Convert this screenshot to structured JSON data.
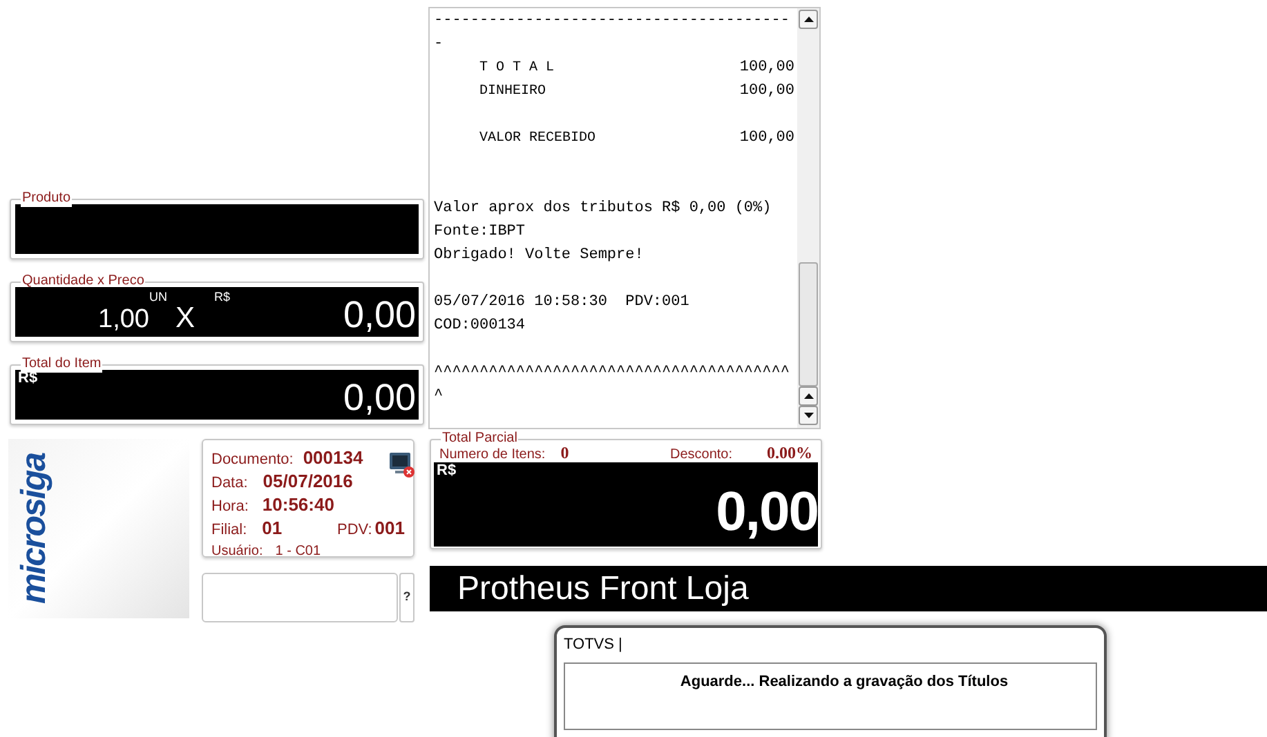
{
  "fields": [
    {
      "kind": "product",
      "legend": "Produto"
    },
    {
      "kind": "qty_price",
      "legend": "Quantidade x Preco",
      "quantity": "1,00",
      "unit": "UN",
      "times": "X",
      "currency": "R$",
      "price": "0,00"
    },
    {
      "kind": "item_total",
      "legend": "Total do Item",
      "currency": "R$",
      "value": "0,00"
    }
  ],
  "receipt": {
    "lines": [
      {
        "kind": "text",
        "text": "---------------------------------------"
      },
      {
        "kind": "text",
        "text": "-"
      },
      {
        "kind": "pair",
        "label": "T O T A L",
        "value": "100,00"
      },
      {
        "kind": "pair",
        "label": "DINHEIRO",
        "value": "100,00"
      },
      {
        "kind": "blank"
      },
      {
        "kind": "pair",
        "label": "VALOR RECEBIDO",
        "value": "100,00"
      },
      {
        "kind": "blank"
      },
      {
        "kind": "blank"
      },
      {
        "kind": "text",
        "text": "Valor aprox dos tributos R$ 0,00 (0%)"
      },
      {
        "kind": "text",
        "text": "Fonte:IBPT"
      },
      {
        "kind": "text",
        "text": "Obrigado! Volte Sempre!"
      },
      {
        "kind": "blank"
      },
      {
        "kind": "text",
        "text": "05/07/2016 10:58:30  PDV:001"
      },
      {
        "kind": "text",
        "text": "COD:000134"
      },
      {
        "kind": "blank"
      },
      {
        "kind": "text",
        "text": "^^^^^^^^^^^^^^^^^^^^^^^^^^^^^^^^^^^^^^^"
      },
      {
        "kind": "text",
        "text": "^"
      }
    ]
  },
  "logo": {
    "text": "microsiga"
  },
  "info": {
    "document_label": "Documento:",
    "document": "000134",
    "date_label": "Data:",
    "date": "05/07/2016",
    "time_label": "Hora:",
    "time": "10:56:40",
    "branch_label": "Filial:",
    "branch": "01",
    "pdv_label": "PDV:",
    "pdv": "001",
    "user_label": "Usuário:",
    "user": "1 - C01"
  },
  "help_button": "?",
  "partial_total": {
    "legend": "Total Parcial",
    "items_label": "Numero de Itens:",
    "items": "0",
    "discount_label": "Desconto:",
    "discount": "0.00%",
    "currency": "R$",
    "value": "0,00"
  },
  "banner": "Protheus Front Loja",
  "dialog": {
    "title": "TOTVS |",
    "message": "Aguarde... Realizando a gravação dos Títulos"
  }
}
